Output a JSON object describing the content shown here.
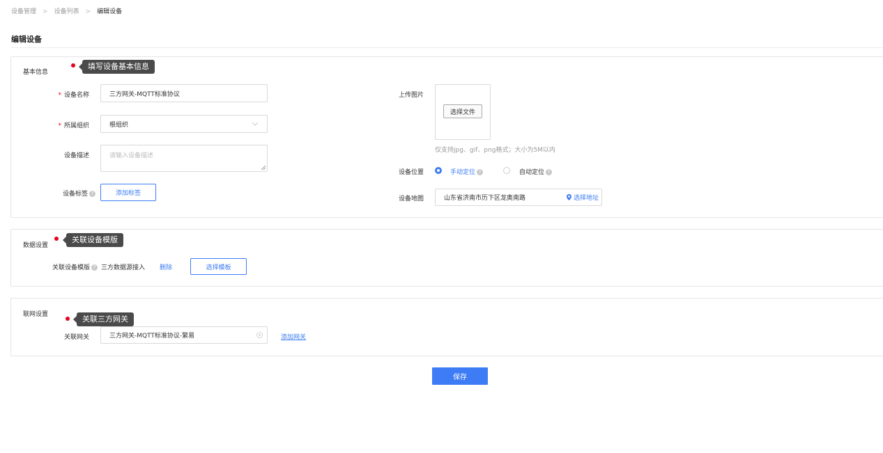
{
  "breadcrumb": {
    "items": [
      "设备管理",
      "设备列表",
      "编辑设备"
    ]
  },
  "page": {
    "title": "编辑设备",
    "save_label": "保存"
  },
  "basic": {
    "section_label": "基本信息",
    "tip": "填写设备基本信息",
    "name_label": "设备名称",
    "name_value": "三方网关-MQTT标准协议",
    "org_label": "所属组织",
    "org_value": "根组织",
    "desc_label": "设备描述",
    "desc_placeholder": "请输入设备描述",
    "tag_label": "设备标签",
    "tag_button": "添加标签",
    "upload_label": "上传图片",
    "upload_button": "选择文件",
    "upload_hint": "仅支持jpg、gif、png格式；大小为5M以内",
    "location_label": "设备位置",
    "manual_label": "手动定位",
    "auto_label": "自动定位",
    "map_label": "设备地图",
    "map_value": "山东省济南市历下区龙奥南路",
    "map_button": "选择地址",
    "selected_location": "manual"
  },
  "data_settings": {
    "section_label": "数据设置",
    "tip": "关联设备模版",
    "template_label": "关联设备模版",
    "template_value": "三方数据源接入",
    "delete_label": "删除",
    "select_button": "选择模板"
  },
  "network": {
    "section_label": "联网设置",
    "tip": "关联三方网关",
    "gateway_label": "关联网关",
    "gateway_value": "三方网关-MQTT标准协议-繁易",
    "add_gateway": "添加网关"
  },
  "icons": [
    "help-icon",
    "chevron-down-icon",
    "location-pin-icon",
    "clear-icon",
    "resize-handle-icon"
  ],
  "colors": {
    "accent": "#3d7cf4",
    "required": "#e8001c",
    "tooltip": "#4a4a4a"
  }
}
